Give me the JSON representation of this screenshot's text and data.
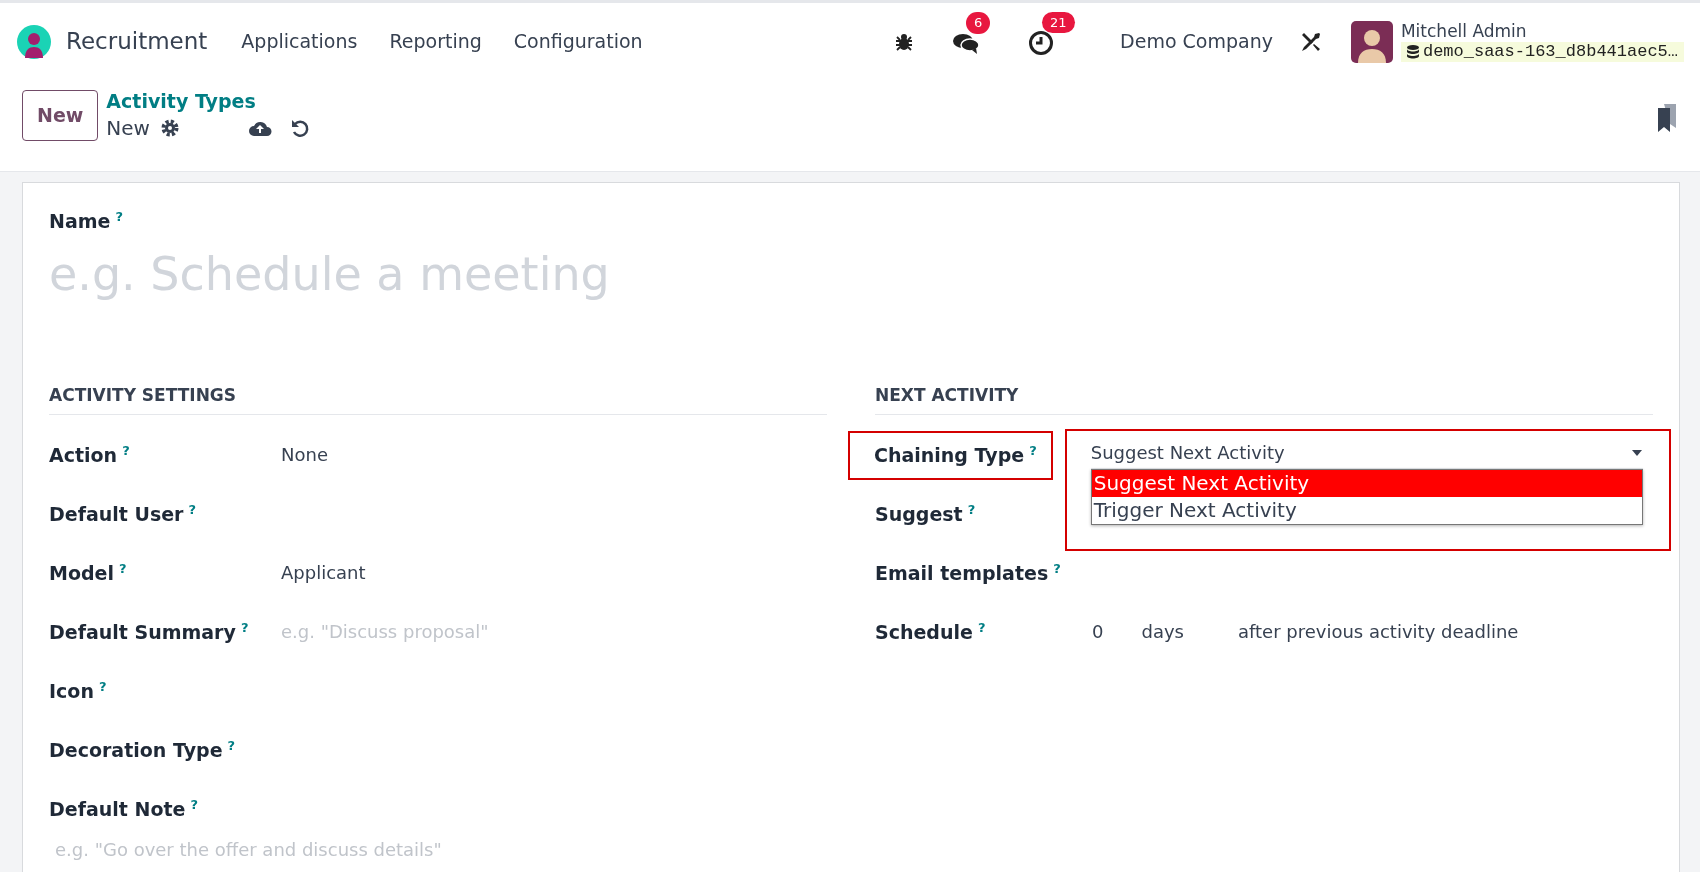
{
  "navbar": {
    "app_name": "Recruitment",
    "menu": [
      "Applications",
      "Reporting",
      "Configuration"
    ],
    "messages_badge": "6",
    "activities_badge": "21",
    "company": "Demo Company",
    "user_name": "Mitchell Admin",
    "database": "demo_saas-163_d8b441aec5…"
  },
  "control_panel": {
    "new_button": "New",
    "breadcrumb": "Activity Types",
    "record": "New"
  },
  "form": {
    "name_label": "Name",
    "name_help": "?",
    "name_placeholder": "e.g. Schedule a meeting",
    "sections": [
      {
        "title": "ACTIVITY SETTINGS",
        "fields": [
          {
            "kind": "inline",
            "label": "Action",
            "help": "?",
            "value": "None"
          },
          {
            "kind": "inline",
            "label": "Default User",
            "help": "?"
          },
          {
            "kind": "inline",
            "label": "Model",
            "help": "?",
            "value": "Applicant"
          },
          {
            "kind": "inline",
            "label": "Default Summary",
            "help": "?",
            "placeholder": "e.g. \"Discuss proposal\""
          },
          {
            "kind": "inline",
            "label": "Icon",
            "help": "?"
          },
          {
            "kind": "inline",
            "label": "Decoration Type",
            "help": "?"
          },
          {
            "kind": "stacked",
            "label": "Default Note",
            "help": "?",
            "placeholder": "e.g. \"Go over the offer and discuss details\""
          }
        ]
      },
      {
        "title": "NEXT ACTIVITY",
        "fields": [
          {
            "kind": "dropdown",
            "label": "Chaining Type",
            "help": "?",
            "annotated": true,
            "value": "Suggest Next Activity",
            "expanded": true,
            "options": [
              {
                "label": "Suggest Next Activity",
                "selected": true
              },
              {
                "label": "Trigger Next Activity",
                "selected": false
              }
            ]
          },
          {
            "kind": "inline",
            "label": "Suggest",
            "help": "?"
          },
          {
            "kind": "inline",
            "label": "Email templates",
            "help": "?"
          },
          {
            "kind": "schedule",
            "label": "Schedule",
            "help": "?",
            "parts": [
              "0",
              "days",
              "after previous activity deadline"
            ]
          }
        ]
      }
    ]
  }
}
